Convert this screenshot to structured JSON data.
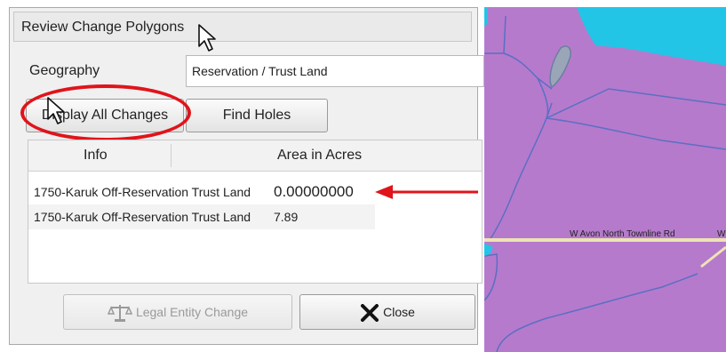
{
  "dialog": {
    "title": "Review Change Polygons",
    "geography_label": "Geography",
    "geography_value": "Reservation / Trust Land",
    "display_all_label": "Display All Changes",
    "find_holes_label": "Find Holes",
    "table": {
      "columns": [
        "Info",
        "Area in Acres"
      ],
      "rows": [
        {
          "info": "1750-Karuk Off-Reservation Trust Land",
          "area": "0.00000000"
        },
        {
          "info": "1750-Karuk Off-Reservation Trust Land",
          "area": "7.89"
        }
      ]
    },
    "legal_entity_label": "Legal Entity Change",
    "close_label": "Close"
  },
  "map": {
    "road_label": "W Avon North Townline Rd",
    "road_label_cut": "W",
    "colors": {
      "land": "#b57acc",
      "water": "#22c5e6",
      "road": "#efe3b4",
      "line": "#5b6fc4"
    }
  },
  "annotations": {
    "highlight_color": "#e0141b"
  }
}
